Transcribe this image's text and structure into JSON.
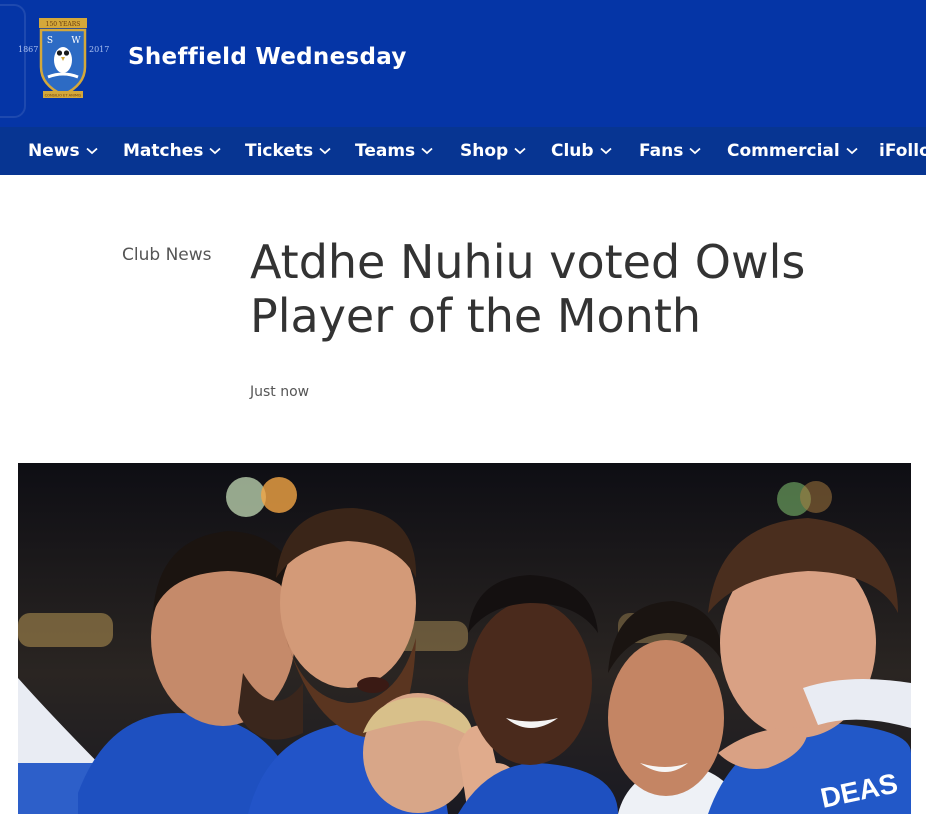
{
  "site": {
    "name": "Sheffield Wednesday",
    "crest": {
      "banner_text": "150 YEARS",
      "letters": [
        "S",
        "W"
      ],
      "year_left": "1867",
      "year_right": "2017",
      "motto": "CONSILIO ET ANIMIS"
    }
  },
  "nav": {
    "items": [
      {
        "label": "News"
      },
      {
        "label": "Matches"
      },
      {
        "label": "Tickets"
      },
      {
        "label": "Teams"
      },
      {
        "label": "Shop"
      },
      {
        "label": "Club"
      },
      {
        "label": "Fans"
      },
      {
        "label": "Commercial"
      },
      {
        "label": "iFollo"
      }
    ]
  },
  "article": {
    "category": "Club News",
    "title_line1": "Atdhe Nuhiu voted Owls",
    "title_line2": "Player of the Month",
    "timestamp": "Just now"
  },
  "hero": {
    "shirt_text": "DEAS"
  },
  "colors": {
    "header_bg": "#0535a6",
    "nav_bg": "#073592",
    "crest_gold": "#d4a83a",
    "crest_blue": "#2d6bc4"
  }
}
